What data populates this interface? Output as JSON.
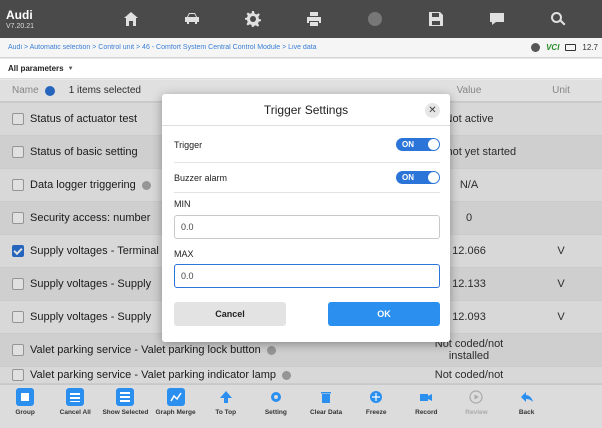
{
  "app": {
    "brand": "Audi",
    "version": "V7.20.21"
  },
  "top_icons": [
    "home-icon",
    "vehicle-icon",
    "settings-icon",
    "print-icon",
    "help-icon",
    "save-icon",
    "message-icon",
    "search-icon"
  ],
  "breadcrumb": "Audi > Automatic selection > Control unit > 46 - Comfort System Central Control Module > Live data",
  "status": {
    "vci": "VCI",
    "battery": "12.7"
  },
  "filter": {
    "label": "All parameters"
  },
  "table": {
    "col_name": "Name",
    "selected_text": "1 items selected",
    "col_value": "Value",
    "col_unit": "Unit",
    "rows": [
      {
        "name": "Status of actuator test",
        "value": "Not active",
        "unit": "",
        "checked": false
      },
      {
        "name": "Status of basic setting",
        "value": "Was not yet started",
        "unit": "",
        "checked": false
      },
      {
        "name": "Data logger triggering",
        "value": "N/A",
        "unit": "",
        "checked": false
      },
      {
        "name": "Security access: number",
        "value": "0",
        "unit": "",
        "checked": false
      },
      {
        "name": "Supply voltages - Terminal",
        "value": "12.066",
        "unit": "V",
        "checked": true
      },
      {
        "name": "Supply voltages - Supply",
        "value": "12.133",
        "unit": "V",
        "checked": false
      },
      {
        "name": "Supply voltages - Supply",
        "value": "12.093",
        "unit": "V",
        "checked": false
      },
      {
        "name": "Valet parking service - Valet parking lock button",
        "value": "Not coded/not installed",
        "unit": "",
        "checked": false
      },
      {
        "name": "Valet parking service - Valet parking indicator lamp",
        "value": "Not coded/not",
        "unit": "",
        "checked": false
      }
    ]
  },
  "dialog": {
    "title": "Trigger Settings",
    "trigger_label": "Trigger",
    "trigger_state": "ON",
    "buzzer_label": "Buzzer alarm",
    "buzzer_state": "ON",
    "min_label": "MIN",
    "min_value": "0.0",
    "max_label": "MAX",
    "max_value": "0.0",
    "cancel_label": "Cancel",
    "ok_label": "OK"
  },
  "toolbar": [
    {
      "label": "Group",
      "icon": "group-icon",
      "color": "#2b8ff0",
      "disabled": false
    },
    {
      "label": "Cancel All",
      "icon": "cancel-all-icon",
      "color": "#2b8ff0",
      "disabled": false
    },
    {
      "label": "Show Selected",
      "icon": "show-selected-icon",
      "color": "#2b8ff0",
      "disabled": false
    },
    {
      "label": "Graph Merge",
      "icon": "graph-merge-icon",
      "color": "#2b8ff0",
      "disabled": false
    },
    {
      "label": "To Top",
      "icon": "to-top-icon",
      "color": "#2b8ff0",
      "disabled": false
    },
    {
      "label": "Setting",
      "icon": "setting-icon",
      "color": "#2b8ff0",
      "disabled": false
    },
    {
      "label": "Clear Data",
      "icon": "clear-data-icon",
      "color": "#2b8ff0",
      "disabled": false
    },
    {
      "label": "Freeze",
      "icon": "freeze-icon",
      "color": "#2b8ff0",
      "disabled": false
    },
    {
      "label": "Record",
      "icon": "record-icon",
      "color": "#2b8ff0",
      "disabled": false
    },
    {
      "label": "Review",
      "icon": "review-icon",
      "color": "#aaaaaa",
      "disabled": true
    },
    {
      "label": "Back",
      "icon": "back-icon",
      "color": "#2b8ff0",
      "disabled": false
    }
  ]
}
